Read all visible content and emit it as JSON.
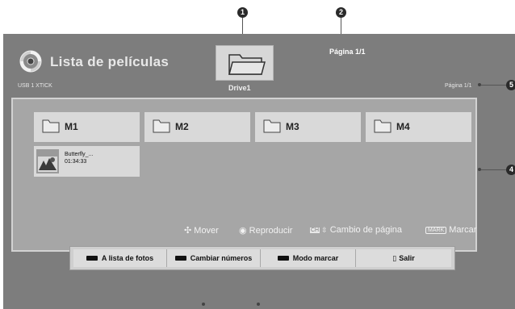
{
  "header": {
    "title": "Lista de películas",
    "source": "USB 1 XTICK",
    "drive_label": "Drive1",
    "page_top": "Página 1/1",
    "page_right": "Página 1/1"
  },
  "folders": [
    {
      "label": "M1"
    },
    {
      "label": "M2"
    },
    {
      "label": "M3"
    },
    {
      "label": "M4"
    }
  ],
  "movie": {
    "name": "Butterfly_...",
    "duration": "01:34:33"
  },
  "hints": {
    "move": "Mover",
    "play": "Reproducir",
    "ch_badge": "CH",
    "page_change": "Cambio de página",
    "mark_badge": "MARK",
    "mark": "Marcar"
  },
  "buttons": {
    "photos": "A lista de fotos",
    "numbers": "Cambiar números",
    "mark_mode": "Modo marcar",
    "exit": "Salir"
  },
  "callouts": {
    "c1": "1",
    "c2": "2",
    "c5": "5",
    "c4": "4"
  },
  "colors": {
    "panel": "#7d7d7d",
    "content": "#a6a6a6",
    "tile": "#d9d9d9",
    "callout": "#2a2a2a"
  }
}
